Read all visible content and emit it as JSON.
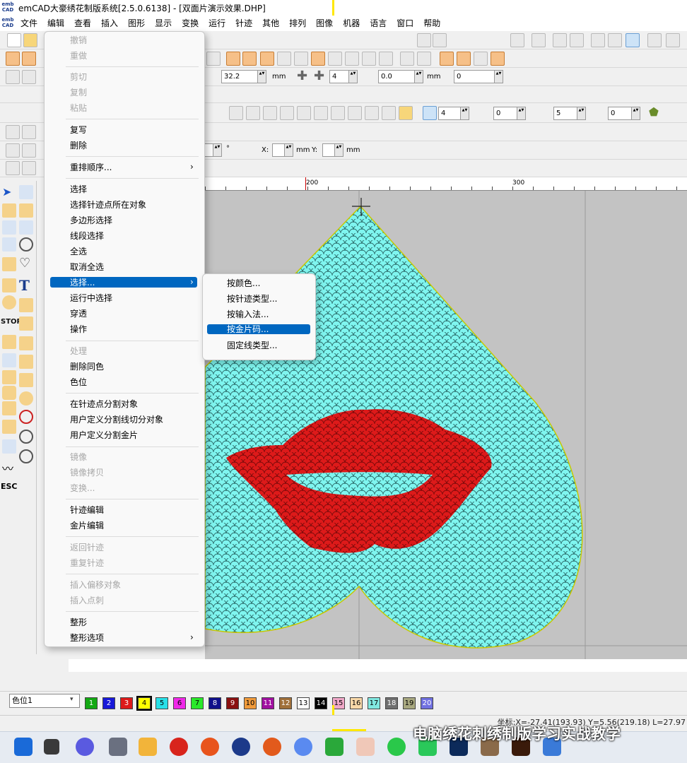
{
  "window": {
    "title": "emCAD大豪绣花制版系统[2.5.0.6138] - [双面片演示效果.DHP]",
    "app_logo": "emb CAD"
  },
  "menubar": [
    "文件",
    "编辑",
    "查看",
    "插入",
    "图形",
    "显示",
    "变换",
    "运行",
    "针迹",
    "其他",
    "排列",
    "图像",
    "机器",
    "语言",
    "窗口",
    "帮助"
  ],
  "toolbar": {
    "angle_value": "32.2",
    "unit_mm": "mm",
    "count_value": "4",
    "offset_value": "0.0",
    "offset2_value": "0",
    "density_value": "4",
    "gap_value": "0",
    "repeat_value": "5",
    "layer_value": "0",
    "rotate_deg": "°",
    "x_label": "X:",
    "y_label": "Y:",
    "x_unit": "mm",
    "y_unit": "mm"
  },
  "ruler": {
    "tick_200": "200",
    "tick_300": "300"
  },
  "edit_menu": {
    "items": [
      {
        "label": "撤销",
        "disabled": true
      },
      {
        "label": "重做",
        "disabled": true
      },
      {
        "label": "剪切",
        "disabled": true
      },
      {
        "label": "复制",
        "disabled": true
      },
      {
        "label": "粘贴",
        "disabled": true
      },
      {
        "label": "复写",
        "disabled": false
      },
      {
        "label": "删除",
        "disabled": false
      },
      {
        "label": "重排顺序...",
        "disabled": false,
        "submenu": true
      },
      {
        "label": "选择",
        "disabled": false
      },
      {
        "label": "选择针迹点所在对象",
        "disabled": false
      },
      {
        "label": "多边形选择",
        "disabled": false
      },
      {
        "label": "线段选择",
        "disabled": false
      },
      {
        "label": "全选",
        "disabled": false
      },
      {
        "label": "取消全选",
        "disabled": false
      },
      {
        "label": "选择...",
        "disabled": false,
        "submenu": true,
        "highlighted": true
      },
      {
        "label": "运行中选择",
        "disabled": false
      },
      {
        "label": "穿透",
        "disabled": false
      },
      {
        "label": "操作",
        "disabled": false
      },
      {
        "label": "处理",
        "disabled": true
      },
      {
        "label": "删除同色",
        "disabled": false
      },
      {
        "label": "色位",
        "disabled": false
      },
      {
        "label": "在针迹点分割对象",
        "disabled": false
      },
      {
        "label": "用户定义分割线切分对象",
        "disabled": false
      },
      {
        "label": "用户定义分割金片",
        "disabled": false
      },
      {
        "label": "镜像",
        "disabled": true
      },
      {
        "label": "镜像拷贝",
        "disabled": true
      },
      {
        "label": "变换...",
        "disabled": true
      },
      {
        "label": "针迹编辑",
        "disabled": false
      },
      {
        "label": "金片编辑",
        "disabled": false
      },
      {
        "label": "返回针迹",
        "disabled": true
      },
      {
        "label": "重复针迹",
        "disabled": true
      },
      {
        "label": "插入偏移对象",
        "disabled": true
      },
      {
        "label": "插入点刺",
        "disabled": true
      },
      {
        "label": "整形",
        "disabled": false
      },
      {
        "label": "整形选项",
        "disabled": false,
        "submenu": true
      }
    ]
  },
  "select_submenu": [
    "按颜色...",
    "按针迹类型...",
    "按输入法...",
    "按金片码...",
    "固定线类型..."
  ],
  "select_submenu_highlight": "按金片码...",
  "color_bar": {
    "selected": "色位1",
    "swatches": [
      {
        "n": "1",
        "color": "#13a813"
      },
      {
        "n": "2",
        "color": "#1818d8"
      },
      {
        "n": "3",
        "color": "#dd1a1a"
      },
      {
        "n": "4",
        "color": "#ffff00"
      },
      {
        "n": "5",
        "color": "#28e0e8"
      },
      {
        "n": "6",
        "color": "#f028e8"
      },
      {
        "n": "7",
        "color": "#2ae82a"
      },
      {
        "n": "8",
        "color": "#10108a"
      },
      {
        "n": "9",
        "color": "#8a1010"
      },
      {
        "n": "10",
        "color": "#f09a3a"
      },
      {
        "n": "11",
        "color": "#a010a0"
      },
      {
        "n": "12",
        "color": "#a0703a"
      },
      {
        "n": "13",
        "color": "#ffffff"
      },
      {
        "n": "14",
        "color": "#000000"
      },
      {
        "n": "15",
        "color": "#f0a8c8"
      },
      {
        "n": "16",
        "color": "#f8d8a8"
      },
      {
        "n": "17",
        "color": "#80e8e0"
      },
      {
        "n": "18",
        "color": "#707070"
      },
      {
        "n": "19",
        "color": "#a8a880"
      },
      {
        "n": "20",
        "color": "#7070e0"
      }
    ]
  },
  "status": {
    "coords": "坐标:X=-27.41(193.93) Y=5.56(219.18) L=27.97"
  },
  "watermark": "电脑绣花刺绣制版学习实战教学",
  "colors": {
    "sequin": "#7ff5ef",
    "lips": "#dd1a1a",
    "outline": "#d8d800",
    "menu_highlight": "#0067c0"
  }
}
